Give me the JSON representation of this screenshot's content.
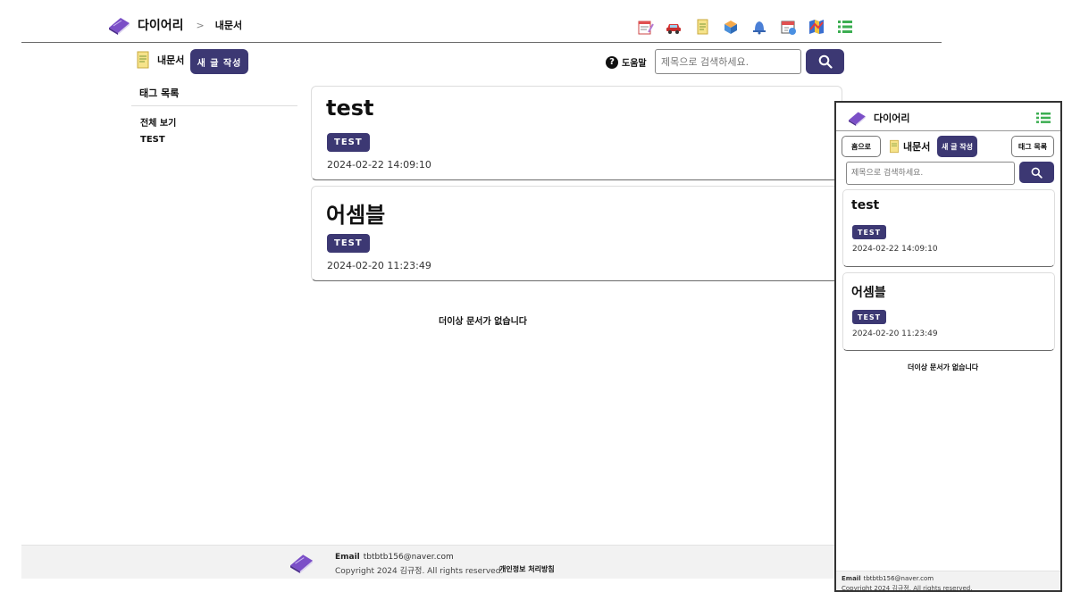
{
  "app": {
    "title": "다이어리"
  },
  "breadcrumb": {
    "separator": ">",
    "current": "내문서"
  },
  "nav_icons": [
    "diary-icon",
    "car-icon",
    "document-icon",
    "package-icon",
    "bell-icon",
    "calendar-icon",
    "map-icon",
    "list-icon"
  ],
  "subbar": {
    "doc_label": "내문서",
    "new_button": "새 글 작성"
  },
  "help": {
    "icon": "?",
    "label": "도움말"
  },
  "search": {
    "placeholder": "제목으로 검색하세요."
  },
  "tags": {
    "title": "태그 목록",
    "items": [
      "전체 보기",
      "TEST"
    ]
  },
  "posts": [
    {
      "title": "test",
      "tag": "TEST",
      "date": "2024-02-22 14:09:10"
    },
    {
      "title": "어셈블",
      "tag": "TEST",
      "date": "2024-02-20 11:23:49"
    }
  ],
  "no_more": "더이상 문서가 없습니다",
  "footer": {
    "email_label": "Email",
    "email": "tbtbtb156@naver.com",
    "copyright": "Copyright 2024 김규정. All rights reserved.",
    "privacy": "개인정보 처리방침"
  },
  "mobile": {
    "title": "다이어리",
    "home_button": "홈으로",
    "doc_label": "내문서",
    "new_button": "새 글 작성",
    "tags_button": "태그 목록",
    "search_placeholder": "제목으로 검색하세요.",
    "posts": [
      {
        "title": "test",
        "tag": "TEST",
        "date": "2024-02-22 14:09:10"
      },
      {
        "title": "어셈블",
        "tag": "TEST",
        "date": "2024-02-20 11:23:49"
      }
    ],
    "no_more": "더이상 문서가 없습니다",
    "footer_email_label": "Email",
    "footer_email": "tbtbtb156@naver.com",
    "footer_copyright": "Copyright 2024 김규정. All rights reserved."
  },
  "colors": {
    "accent": "#3c3873",
    "footer_bg": "#f2f2f2",
    "divider": "#6b6b6b"
  }
}
